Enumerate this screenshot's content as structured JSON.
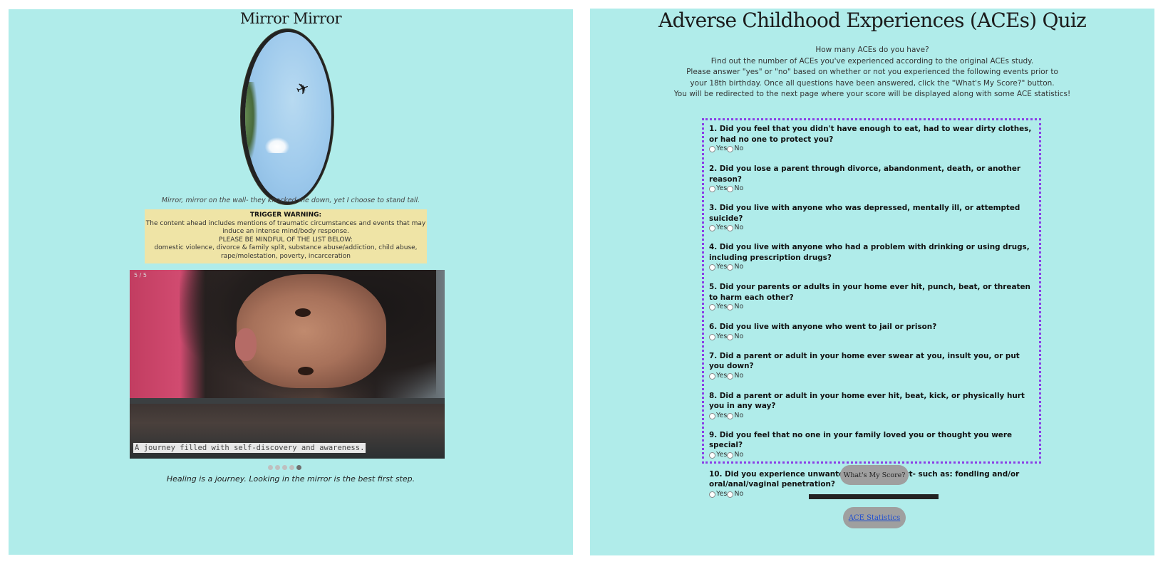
{
  "left": {
    "title": "Mirror Mirror",
    "mirror_caption": "Mirror, mirror on the wall- they knocked me down, yet I choose to stand tall.",
    "warning": {
      "title": "TRIGGER WARNING:",
      "line1": "The content ahead includes mentions of traumatic circumstances and events that may induce an intense mind/body response.",
      "line2": "PLEASE BE MINDFUL OF THE LIST BELOW:",
      "line3": "domestic violence, divorce & family split, substance abuse/addiction, child abuse, rape/molestation, poverty, incarceration"
    },
    "slideshow": {
      "slide_number": "5 / 5",
      "caption": "A journey filled with self-discovery and awareness.",
      "dot_count": 5,
      "active_index": 4
    },
    "footer_text": "Healing is a journey. Looking in the mirror is the best first step."
  },
  "right": {
    "title": "Adverse Childhood Experiences (ACEs) Quiz",
    "intro_lines": [
      "How many ACEs do you have?",
      "Find out the number of ACEs you've experienced according to the original ACEs study.",
      "Please answer \"yes\" or \"no\" based on whether or not you experienced the following events prior to",
      "your 18th birthday. Once all questions have been answered, click the \"What's My Score?\" button.",
      "You will be redirected to the next page where your score will be displayed along with some ACE statistics!"
    ],
    "yes_label": "Yes",
    "no_label": "No",
    "questions": [
      "1. Did you feel that you didn't have enough to eat, had to wear dirty clothes, or had no one to protect you?",
      "2. Did you lose a parent through divorce, abandonment, death, or another reason?",
      "3. Did you live with anyone who was depressed, mentally ill, or attempted suicide?",
      "4. Did you live with anyone who had a problem with drinking or using drugs, including prescription drugs?",
      "5. Did your parents or adults in your home ever hit, punch, beat, or threaten to harm each other?",
      "6. Did you live with anyone who went to jail or prison?",
      "7. Did a parent or adult in your home ever swear at you, insult you, or put you down?",
      "8. Did a parent or adult in your home ever hit, beat, kick, or physically hurt you in any way?",
      "9. Did you feel that no one in your family loved you or thought you were special?",
      "10. Did you experience unwanted sexual contact- such as: fondling and/or oral/anal/vaginal penetration?"
    ],
    "score_button": "What's My Score?",
    "stats_link": "ACE Statistics"
  }
}
